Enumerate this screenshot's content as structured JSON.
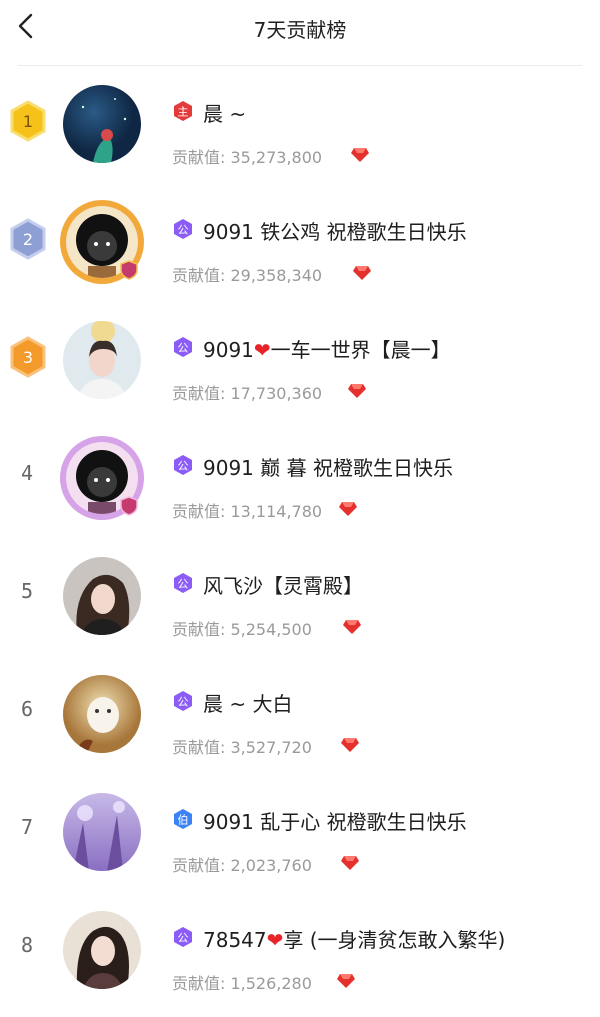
{
  "header": {
    "title": "7天贡献榜",
    "back_icon": "back-chevron-icon"
  },
  "score_label": "贡献值: ",
  "colors": {
    "gold": "#f6c21a",
    "silver": "#8e9fd4",
    "bronze": "#f39a2a",
    "badge_purple": "#8b5cf6",
    "badge_blue": "#3b82f6",
    "badge_red": "#e33b3b",
    "gem": "#e5312e"
  },
  "entries": [
    {
      "rank": "1",
      "badge": "主",
      "name": "晨 ~",
      "score": "35,273,800"
    },
    {
      "rank": "2",
      "badge": "公",
      "name": "9091 铁公鸡 祝橙歌生日快乐",
      "score": "29,358,340"
    },
    {
      "rank": "3",
      "badge": "公",
      "name_pre": "9091",
      "name_post": "一车一世界【晨一】",
      "score": "17,730,360"
    },
    {
      "rank": "4",
      "badge": "公",
      "name": "9091 巅 暮 祝橙歌生日快乐",
      "score": "13,114,780"
    },
    {
      "rank": "5",
      "badge": "公",
      "name": "风飞沙【灵霄殿】",
      "score": "5,254,500"
    },
    {
      "rank": "6",
      "badge": "公",
      "name": "晨 ~ 大白",
      "score": "3,527,720"
    },
    {
      "rank": "7",
      "badge": "伯",
      "name": "9091 乱于心 祝橙歌生日快乐",
      "score": "2,023,760"
    },
    {
      "rank": "8",
      "badge": "公",
      "name_pre": "78547",
      "name_post": "享 (一身清贫怎敢入繁华)",
      "score": "1,526,280"
    }
  ]
}
